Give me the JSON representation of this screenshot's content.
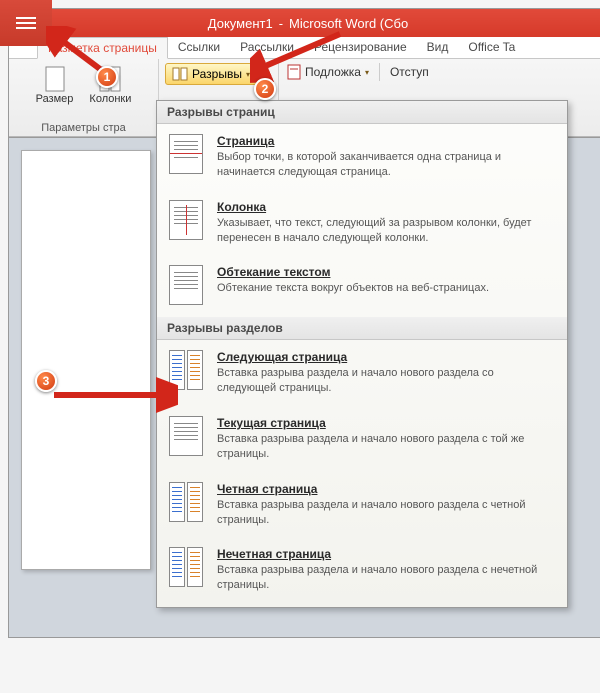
{
  "title_prefix": "Документ1",
  "title_suffix": "Microsoft Word (Сбо",
  "tabs": {
    "page_layout": "Разметка страницы",
    "references": "Ссылки",
    "mailings": "Рассылки",
    "review": "Рецензирование",
    "view": "Вид",
    "office_tab": "Office Ta"
  },
  "ribbon": {
    "size_label": "Размер",
    "columns_label": "Колонки",
    "page_setup_group": "Параметры стра",
    "breaks_button": "Разрывы",
    "watermark_button": "Подложка",
    "indent_label": "Отступ"
  },
  "dropdown": {
    "section1_header": "Разрывы страниц",
    "items1": [
      {
        "title": "Страница",
        "desc": "Выбор точки, в которой заканчивается одна страница и начинается следующая страница."
      },
      {
        "title": "Колонка",
        "desc": "Указывает, что текст, следующий за разрывом колонки, будет перенесен в начало следующей колонки."
      },
      {
        "title": "Обтекание текстом",
        "desc": "Обтекание текста вокруг объектов на веб-страницах."
      }
    ],
    "section2_header": "Разрывы разделов",
    "items2": [
      {
        "title": "Следующая страница",
        "desc": "Вставка разрыва раздела и начало нового раздела со следующей страницы."
      },
      {
        "title": "Текущая страница",
        "desc": "Вставка разрыва раздела и начало нового раздела с той же страницы."
      },
      {
        "title": "Четная страница",
        "desc": "Вставка разрыва раздела и начало нового раздела с четной страницы."
      },
      {
        "title": "Нечетная страница",
        "desc": "Вставка разрыва раздела и начало нового раздела с нечетной страницы."
      }
    ]
  },
  "callouts": {
    "c1": "1",
    "c2": "2",
    "c3": "3"
  }
}
